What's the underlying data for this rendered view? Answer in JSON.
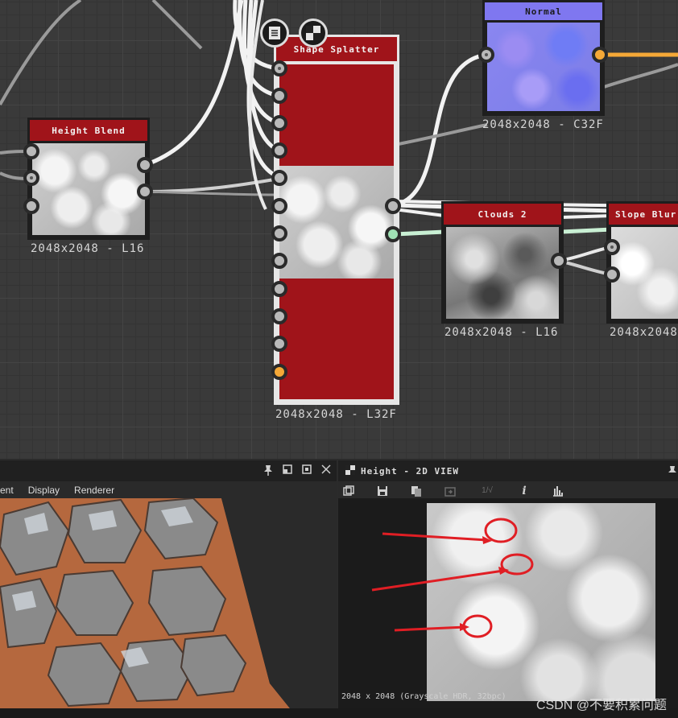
{
  "graph": {
    "nodes": {
      "height_blend": {
        "title": "Height Blend",
        "label": "2048x2048 - L16"
      },
      "shape_splatter": {
        "title": "Shape Splatter",
        "label": "2048x2048 - L32F"
      },
      "normal": {
        "title": "Normal",
        "label": "2048x2048 - C32F"
      },
      "clouds2": {
        "title": "Clouds 2",
        "label": "2048x2048 - L16"
      },
      "slope_blur": {
        "title": "Slope Blur",
        "label": "2048x2048"
      }
    },
    "wire_colors": {
      "grey": "#9a9a9a",
      "white": "#f2f2f2",
      "orange": "#f5a837",
      "green": "#c9f0d4"
    },
    "node_title_color": "#a0141a"
  },
  "panel3d": {
    "menu": [
      "ent",
      "Display",
      "Renderer"
    ],
    "icons": [
      "pin-icon",
      "float-icon",
      "maximize-icon",
      "close-icon"
    ]
  },
  "panel2d": {
    "title": "Height - 2D VIEW",
    "toolbar_icons": [
      "fit-view-icon",
      "save-icon",
      "copy-icon",
      "export-icon",
      "info-icon",
      "histogram-icon"
    ],
    "status": "2048 x 2048 (Grayscale HDR, 32bpc)",
    "annotation_color": "#e01e24"
  },
  "watermark": "CSDN @不要积累问题"
}
